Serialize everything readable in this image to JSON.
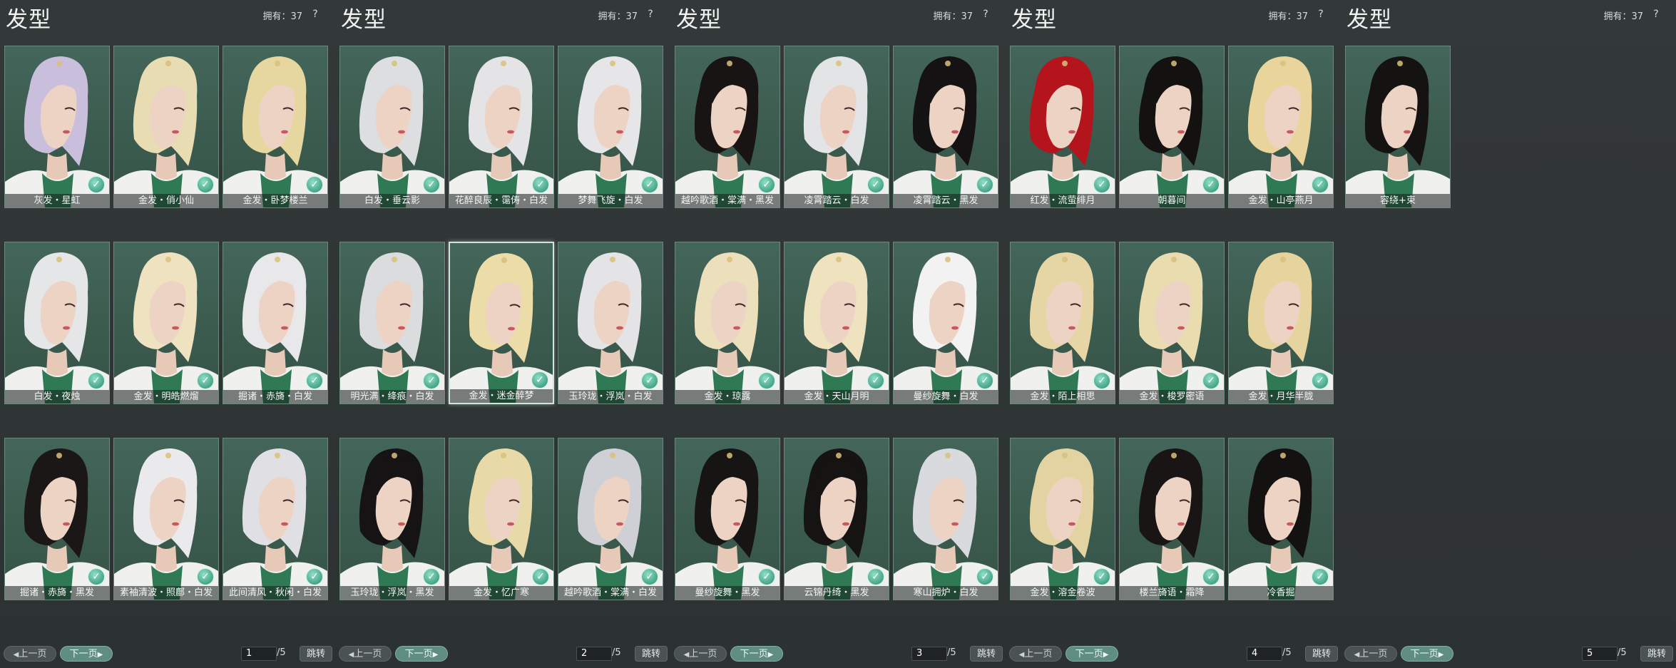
{
  "title": "发型",
  "owned_text": "拥有：37",
  "help_label": "?",
  "prev_label": "上一页",
  "next_label": "下一页",
  "jump_label": "跳转",
  "total_pages_text": "/5",
  "colors": {
    "card_bg": "#3d5b4f",
    "accent": "#5f8d82",
    "background": "#2f3435"
  },
  "pages": [
    {
      "page": "1",
      "items": [
        {
          "label": "灰发・星虹",
          "hair": "#c9bfdc",
          "owned": true
        },
        {
          "label": "金发・俏小仙",
          "hair": "#e8dcb2",
          "owned": true
        },
        {
          "label": "金发・卧梦楼兰",
          "hair": "#e6d7a1",
          "owned": true
        },
        {
          "label": "白发・夜烛",
          "hair": "#e4e6e8",
          "owned": true
        },
        {
          "label": "金发・明皓燃熘",
          "hair": "#eee2c0",
          "owned": true
        },
        {
          "label": "掘诸・赤旖・白发",
          "hair": "#e8e8ea",
          "owned": true
        },
        {
          "label": "掘诸・赤旖・黑发",
          "hair": "#1b1717",
          "owned": true
        },
        {
          "label": "素袖清波・照鄜・白发",
          "hair": "#eaeaec",
          "owned": true
        },
        {
          "label": "此间清风・秋闲・白发",
          "hair": "#e0e0e4",
          "owned": true
        }
      ]
    },
    {
      "page": "2",
      "items": [
        {
          "label": "白发・垂云影",
          "hair": "#dcdee0",
          "owned": true
        },
        {
          "label": "花醉良辰・霭俦・白发",
          "hair": "#e4e4e6",
          "owned": true
        },
        {
          "label": "梦舞飞旋・白发",
          "hair": "#e6e6e8",
          "owned": true
        },
        {
          "label": "明光满・绛痕・白发",
          "hair": "#dadcde",
          "owned": true
        },
        {
          "label": "金发・迷金醉梦",
          "hair": "#ecdca8",
          "owned": true,
          "selected": true
        },
        {
          "label": "玉玲珑・浮岚・白发",
          "hair": "#e4e4e6",
          "owned": true
        },
        {
          "label": "玉玲珑・浮岚・黑发",
          "hair": "#151313",
          "owned": true
        },
        {
          "label": "金发・忆广寒",
          "hair": "#e8d9a8",
          "owned": true
        },
        {
          "label": "越吟歌酒・棠满・白发",
          "hair": "#cfd0d6",
          "owned": true
        }
      ]
    },
    {
      "page": "3",
      "items": [
        {
          "label": "越吟歌酒・棠满・黑发",
          "hair": "#181414",
          "owned": true
        },
        {
          "label": "凌霄踏云・白发",
          "hair": "#e2e4e6",
          "owned": true
        },
        {
          "label": "凌霄踏云・黑发",
          "hair": "#141212",
          "owned": true
        },
        {
          "label": "金发・琼露",
          "hair": "#ecdfbc",
          "owned": true
        },
        {
          "label": "金发・天山月明",
          "hair": "#efe3bf",
          "owned": true
        },
        {
          "label": "曼纱旋舞・白发",
          "hair": "#f2f2f2",
          "owned": true
        },
        {
          "label": "曼纱旋舞・黑发",
          "hair": "#171414",
          "owned": true
        },
        {
          "label": "云锦丹绮・黑发",
          "hair": "#161313",
          "owned": true
        },
        {
          "label": "寒山拥炉・白发",
          "hair": "#d9dadd",
          "owned": true
        }
      ]
    },
    {
      "page": "4",
      "items": [
        {
          "label": "红发・流萤绯月",
          "hair": "#b4141b",
          "owned": true
        },
        {
          "label": "朝暮间",
          "hair": "#141111",
          "owned": true
        },
        {
          "label": "金发・山亭燕月",
          "hair": "#e9d59c",
          "owned": true
        },
        {
          "label": "金发・陌上相思",
          "hair": "#e6d6a6",
          "owned": true
        },
        {
          "label": "金发・梭罗密语",
          "hair": "#e9dcae",
          "owned": true
        },
        {
          "label": "金发・月华半胧",
          "hair": "#e6d49e",
          "owned": true
        },
        {
          "label": "金发・溶金卷波",
          "hair": "#e4d3a2",
          "owned": true
        },
        {
          "label": "楼兰旖语・霜降",
          "hair": "#1a1515",
          "owned": true
        },
        {
          "label": "冷香掘",
          "hair": "#141111",
          "owned": true
        }
      ]
    },
    {
      "page": "5",
      "items": [
        {
          "label": "容绕+束",
          "hair": "#151212",
          "owned": false
        }
      ]
    }
  ]
}
